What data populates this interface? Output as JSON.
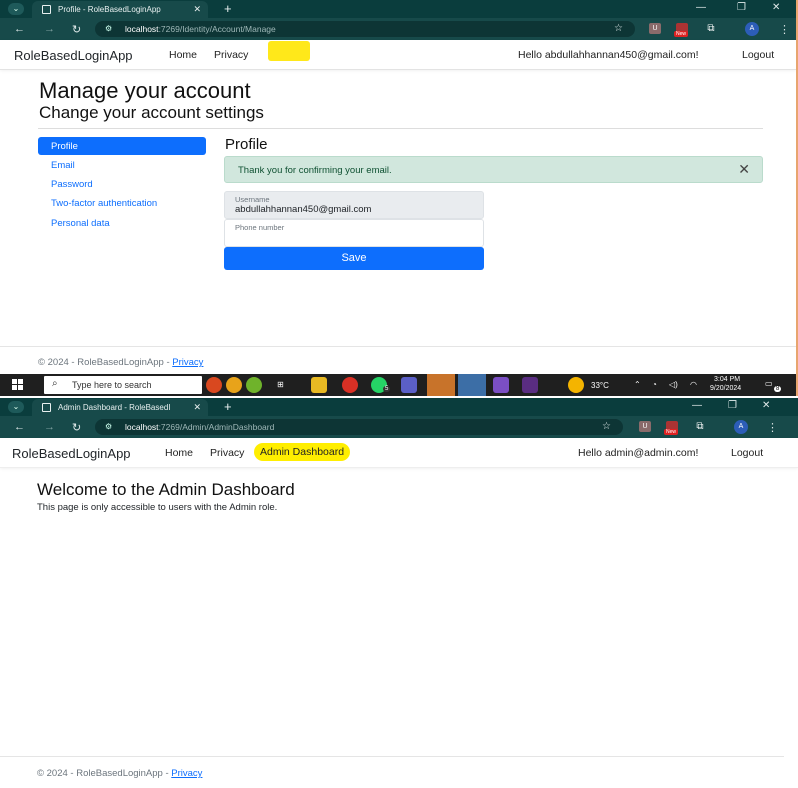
{
  "screen1": {
    "tab_title": "Profile - RoleBasedLoginApp",
    "url_host": "localhost",
    "url_path": ":7269/Identity/Account/Manage",
    "ext_new_badge": "New",
    "avatar_letter": "A",
    "nav": {
      "brand": "RoleBasedLoginApp",
      "home": "Home",
      "privacy": "Privacy",
      "greeting": "Hello abdullahhannan450@gmail.com!",
      "logout": "Logout"
    },
    "page": {
      "title": "Manage your account",
      "subtitle": "Change your account settings",
      "menu": [
        "Profile",
        "Email",
        "Password",
        "Two-factor authentication",
        "Personal data"
      ],
      "section_title": "Profile",
      "alert": "Thank you for confirming your email.",
      "username_label": "Username",
      "username_value": "abdullahhannan450@gmail.com",
      "phone_label": "Phone number",
      "save": "Save"
    },
    "footer": {
      "text": "© 2024 - RoleBasedLoginApp - ",
      "link": "Privacy"
    },
    "taskbar": {
      "search": "Type here to search",
      "badge": "5",
      "temperature": "33°C",
      "time": "3:04 PM",
      "date": "9/20/2024",
      "notif_count": "8"
    }
  },
  "screen2": {
    "tab_title": "Admin Dashboard - RoleBasedI",
    "url_host": "localhost",
    "url_path": ":7269/Admin/AdminDashboard",
    "ext_new_badge": "New",
    "avatar_letter": "A",
    "nav": {
      "brand": "RoleBasedLoginApp",
      "home": "Home",
      "privacy": "Privacy",
      "admin": "Admin Dashboard",
      "greeting": "Hello admin@admin.com!",
      "logout": "Logout"
    },
    "page": {
      "title": "Welcome to the Admin Dashboard",
      "text": "This page is only accessible to users with the Admin role."
    },
    "footer": {
      "text": "© 2024 - RoleBasedLoginApp - ",
      "link": "Privacy"
    }
  },
  "colors": {
    "primary": "#0d6efd",
    "alert_bg": "#d1e7dd",
    "chrome_dark": "#0a3d3d",
    "highlight": "#ffee00"
  }
}
